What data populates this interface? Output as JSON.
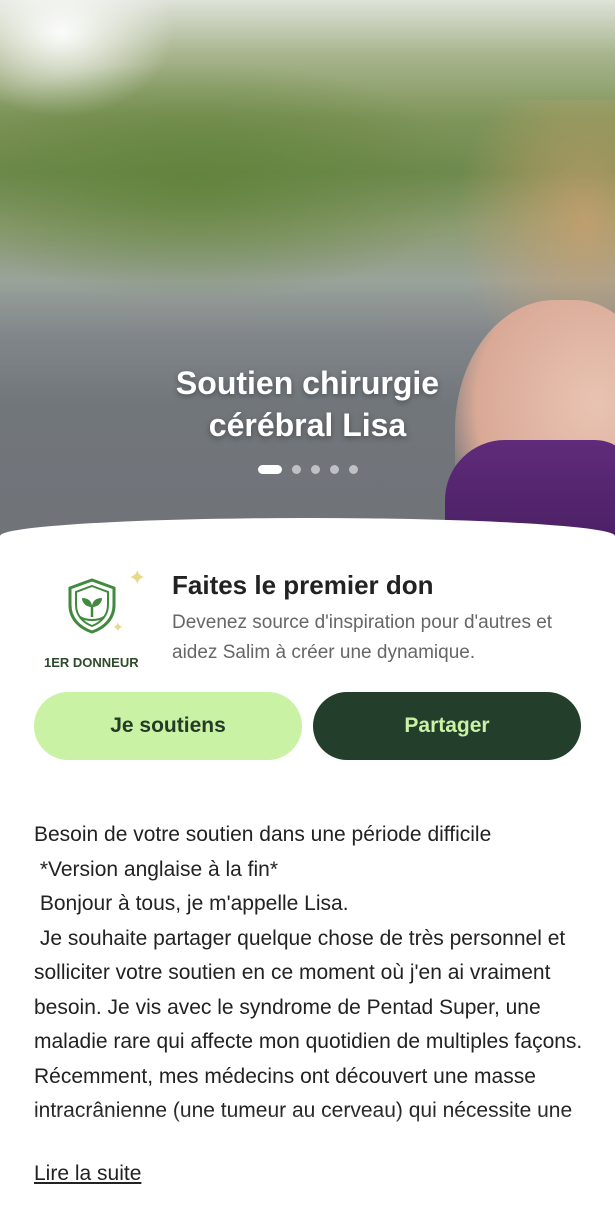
{
  "hero": {
    "title_line1": "Soutien chirurgie",
    "title_line2": "cérébral Lisa",
    "carousel_total": 5,
    "carousel_active": 1
  },
  "donor": {
    "badge_label": "1ER DONNEUR",
    "title": "Faites le premier don",
    "description": "Devenez source d'inspiration pour d'autres et aidez Salim à créer une dynamique."
  },
  "actions": {
    "support_label": "Je soutiens",
    "share_label": "Partager"
  },
  "story": {
    "lines": [
      "Besoin de votre soutien dans une période difficile",
      " *Version anglaise à la fin*",
      " Bonjour à tous, je m'appelle Lisa.",
      " Je souhaite partager quelque chose de très personnel et solliciter votre soutien en ce moment où j'en ai vraiment besoin. Je vis avec le syndrome de Pentad Super, une maladie rare qui affecte mon quotidien de multiples façons. Récemment, mes médecins ont découvert une masse intracrânienne (une tumeur au cerveau) qui nécessite une"
    ],
    "read_more": "Lire la suite"
  },
  "colors": {
    "accent_light": "#c9f2a4",
    "accent_dark": "#243e2c",
    "badge_green": "#3f8a3f"
  },
  "icons": [
    "shield-leaf-icon",
    "sparkle-icon"
  ]
}
